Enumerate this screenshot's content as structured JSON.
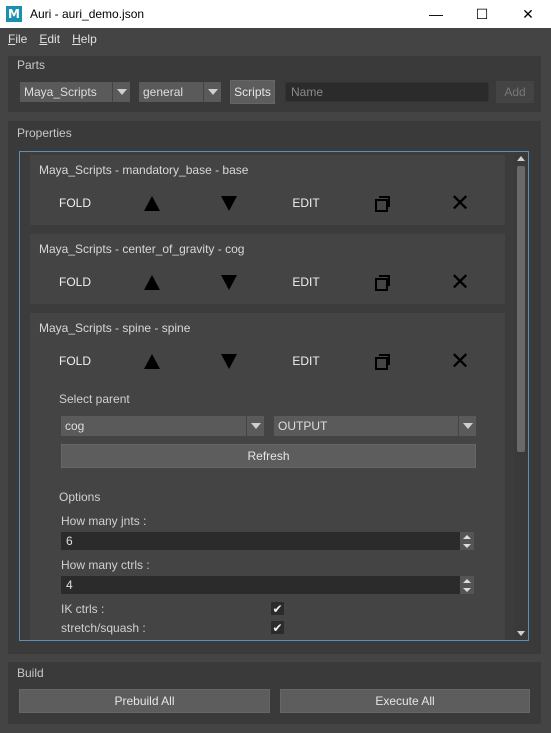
{
  "window": {
    "app_logo": "M",
    "title": "Auri - auri_demo.json",
    "minimize_glyph": "—",
    "maximize_glyph": "☐",
    "close_glyph": "✕"
  },
  "menu": {
    "items": [
      {
        "mnemonic": "F",
        "rest": "ile"
      },
      {
        "mnemonic": "E",
        "rest": "dit"
      },
      {
        "mnemonic": "H",
        "rest": "elp"
      }
    ]
  },
  "parts": {
    "label": "Parts",
    "category_select": "Maya_Scripts",
    "type_select": "general",
    "scripts_button": "Scripts",
    "name_placeholder": "Name",
    "add_button": "Add"
  },
  "properties": {
    "label": "Properties",
    "controls": {
      "fold": "FOLD",
      "edit": "EDIT",
      "delete_glyph": "✕"
    },
    "parts": [
      {
        "title": "Maya_Scripts - mandatory_base - base"
      },
      {
        "title": "Maya_Scripts - center_of_gravity - cog"
      },
      {
        "title": "Maya_Scripts - spine - spine"
      }
    ],
    "spine_settings": {
      "select_parent_label": "Select parent",
      "parent_select": "cog",
      "output_select": "OUTPUT",
      "refresh_button": "Refresh",
      "options_label": "Options",
      "jnts_label": "How many jnts :",
      "jnts_value": "6",
      "ctrls_label": "How many ctrls :",
      "ctrls_value": "4",
      "ik_label": "IK ctrls :",
      "ik_checked": "✔",
      "stretch_label": "stretch/squash :",
      "stretch_checked": "✔"
    }
  },
  "build": {
    "label": "Build",
    "prebuild_button": "Prebuild All",
    "execute_button": "Execute All"
  }
}
